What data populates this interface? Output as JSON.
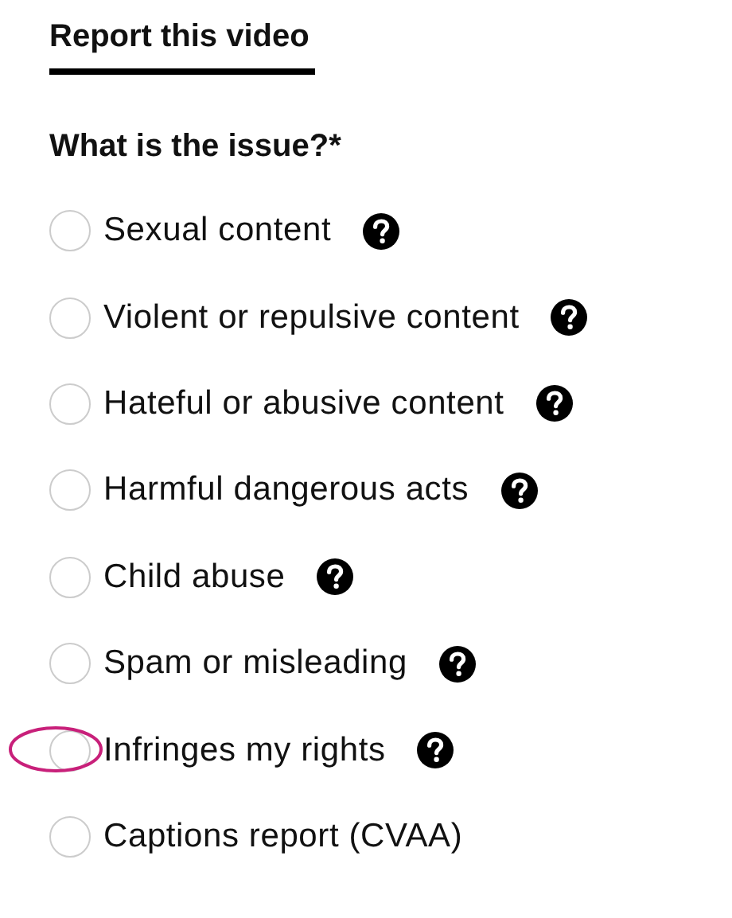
{
  "heading": "Report this video",
  "question": "What is the issue?*",
  "options": [
    {
      "label": "Sexual content",
      "selected": false,
      "help": true,
      "circled": false
    },
    {
      "label": "Violent or repulsive content",
      "selected": false,
      "help": true,
      "circled": false
    },
    {
      "label": "Hateful or abusive content",
      "selected": false,
      "help": true,
      "circled": false
    },
    {
      "label": "Harmful dangerous acts",
      "selected": false,
      "help": true,
      "circled": false
    },
    {
      "label": "Child abuse",
      "selected": false,
      "help": true,
      "circled": false
    },
    {
      "label": "Spam or misleading",
      "selected": false,
      "help": true,
      "circled": false
    },
    {
      "label": "Infringes my rights",
      "selected": false,
      "help": true,
      "circled": true
    },
    {
      "label": "Captions report (CVAA)",
      "selected": false,
      "help": false,
      "circled": false
    }
  ]
}
